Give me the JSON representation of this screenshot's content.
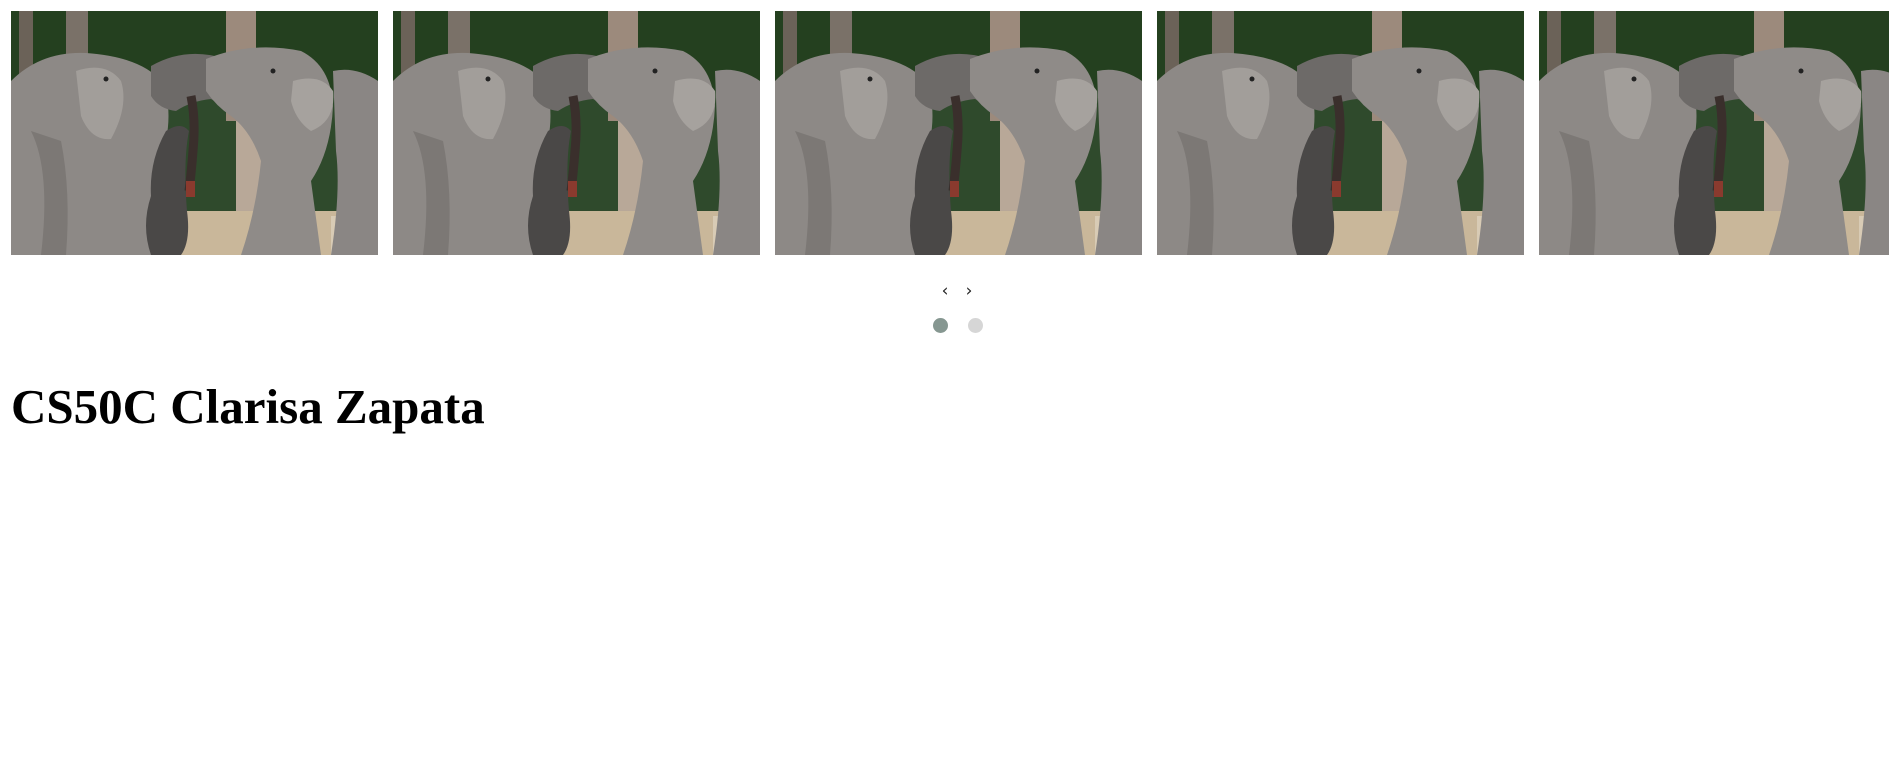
{
  "carousel": {
    "slides": [
      {
        "image": "elephants-photo"
      },
      {
        "image": "elephants-photo"
      },
      {
        "image": "elephants-photo"
      },
      {
        "image": "elephants-photo"
      },
      {
        "image": "elephants-photo"
      }
    ],
    "prev_icon": "chevron-left-icon",
    "next_icon": "chevron-right-icon",
    "prev_label": "‹",
    "next_label": "›",
    "dots_active_color": "#869791",
    "dots_inactive_color": "#d6d6d6",
    "active_page": 1,
    "page_count": 2
  },
  "page": {
    "title": "CS50C Clarisa Zapata"
  }
}
